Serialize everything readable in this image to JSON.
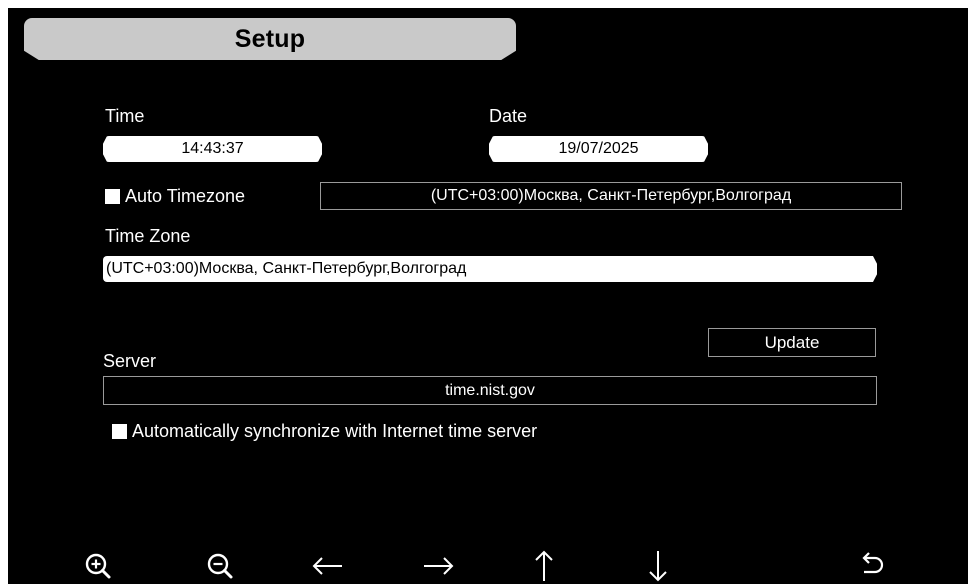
{
  "header": {
    "title": "Setup"
  },
  "time": {
    "label": "Time",
    "value": "14:43:37"
  },
  "date": {
    "label": "Date",
    "value": "19/07/2025"
  },
  "auto_timezone": {
    "label": "Auto Timezone",
    "checked": true,
    "display_value": "(UTC+03:00)Москва, Санкт-Петербург,Волгоград"
  },
  "time_zone": {
    "label": "Time Zone",
    "value": "(UTC+03:00)Москва, Санкт-Петербург,Волгоград"
  },
  "update_button": {
    "label": "Update"
  },
  "server": {
    "label": "Server",
    "value": "time.nist.gov"
  },
  "auto_sync": {
    "label": "Automatically synchronize with Internet time server",
    "checked": true
  },
  "toolbar": {
    "icons": [
      "zoom-in-icon",
      "zoom-out-icon",
      "arrow-left-icon",
      "arrow-right-icon",
      "arrow-up-icon",
      "arrow-down-icon",
      "return-icon"
    ]
  },
  "colors": {
    "background": "#000000",
    "title_tab": "#c9c9c9",
    "text": "#ffffff",
    "field_fill": "#ffffff",
    "field_border": "#9a9a9a"
  }
}
